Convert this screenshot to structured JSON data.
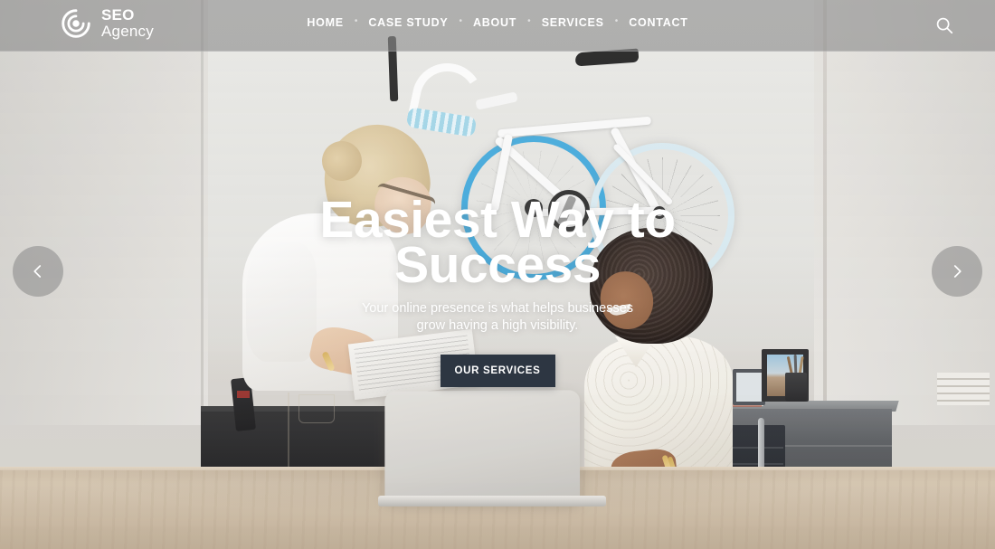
{
  "header": {
    "brand": {
      "logo_icon": "spiral-target-icon",
      "line1": "SEO",
      "line2": "Agency"
    },
    "nav": [
      {
        "label": "HOME"
      },
      {
        "label": "CASE STUDY"
      },
      {
        "label": "ABOUT"
      },
      {
        "label": "SERVICES"
      },
      {
        "label": "CONTACT"
      }
    ],
    "separator": "•",
    "search_icon": "search-icon",
    "background_color": "#8c8c8c"
  },
  "hero": {
    "title_line1": "Easiest Way to",
    "title_line2": "Success",
    "subtitle": "Your online presence is what helps businesses grow having a high visibility.",
    "cta_label": "OUR SERVICES",
    "cta_color": "#2d3642",
    "text_color": "#ffffff"
  },
  "slider": {
    "prev_icon": "chevron-left-icon",
    "next_icon": "chevron-right-icon",
    "control_color": "#878787"
  },
  "photo": {
    "description": "Two women working at a light wood office desk with a laptop; a white bicycle with blue rims mounted on the wall behind them",
    "accent_blue": "#3ea8dc",
    "desk_color": "#cfbfa9"
  }
}
